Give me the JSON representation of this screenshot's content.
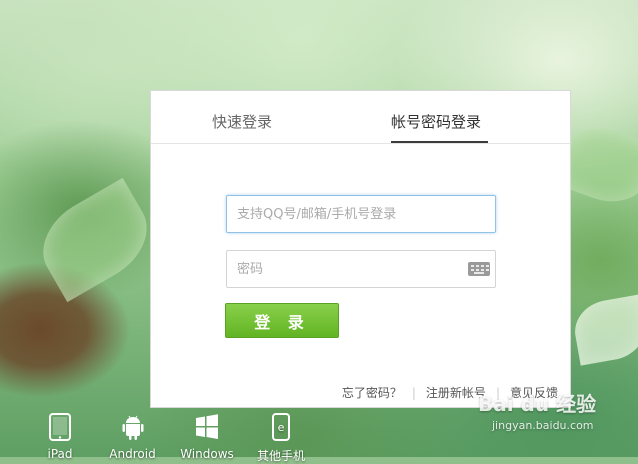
{
  "login": {
    "tabs": [
      {
        "label": "快速登录"
      },
      {
        "label": "帐号密码登录"
      }
    ],
    "username_placeholder": "支持QQ号/邮箱/手机号登录",
    "password_placeholder": "密码",
    "login_button": "登 录",
    "links": {
      "forgot": "忘了密码？",
      "register": "注册新帐号",
      "feedback": "意见反馈"
    }
  },
  "devices": [
    {
      "label": "iPad",
      "icon": "ipad-icon"
    },
    {
      "label": "Android",
      "icon": "android-icon"
    },
    {
      "label": "Windows",
      "icon": "windows-icon"
    },
    {
      "label": "其他手机",
      "icon": "phone-icon"
    }
  ],
  "watermark": {
    "brand": "Bai du 经验",
    "url": "jingyan.baidu.com"
  },
  "colors": {
    "login_button": "#6cbf2f",
    "focus_border": "#8fc2e6",
    "tab_active_underline": "#3c3c3c"
  }
}
